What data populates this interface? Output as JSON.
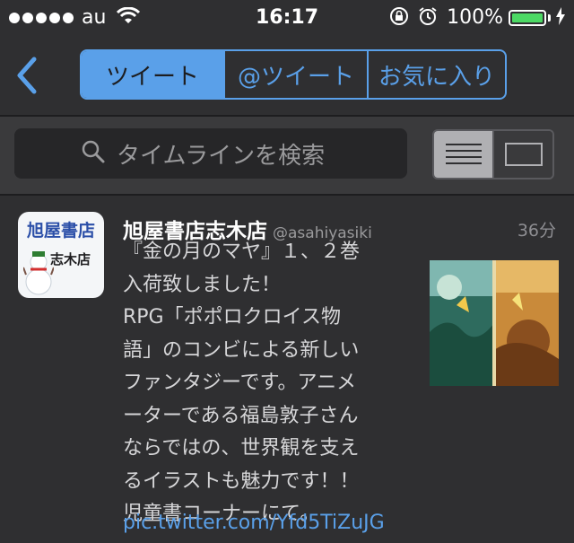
{
  "status_bar": {
    "carrier": "au",
    "time": "16:17",
    "battery_percent": "100%",
    "signal_bars": 5,
    "battery_level": 1.0,
    "battery_color": "#4cd964"
  },
  "nav": {
    "back_icon": "chevron-left-icon",
    "segments": [
      "ツイート",
      "@ツイート",
      "お気に入り"
    ],
    "active_segment": 0,
    "accent_color": "#5aa0e9"
  },
  "search": {
    "placeholder": "タイムラインを検索",
    "icon": "search-icon"
  },
  "view_toggle": {
    "options": [
      "list-view-icon",
      "single-view-icon"
    ],
    "active": 0
  },
  "tweet": {
    "avatar_text_line1": "旭屋書店",
    "avatar_text_line2": "志木店",
    "name": "旭屋書店志木店",
    "handle": "@asahiyasiki",
    "time": "36分",
    "text_lines": [
      "『金の月のマヤ』１、２巻",
      "入荷致しました！",
      "RPG「ポポロクロイス物",
      "語」のコンビによる新しい",
      "ファンタジーです。アニメ",
      "ーターである福島敦子さん",
      "ならではの、世界観を支え",
      "るイラストも魅力です！！",
      "児童書コーナーにて。"
    ],
    "link": "pic.twitter.com/Yfd5TiZuJG",
    "link_color": "#5aa0e9"
  }
}
